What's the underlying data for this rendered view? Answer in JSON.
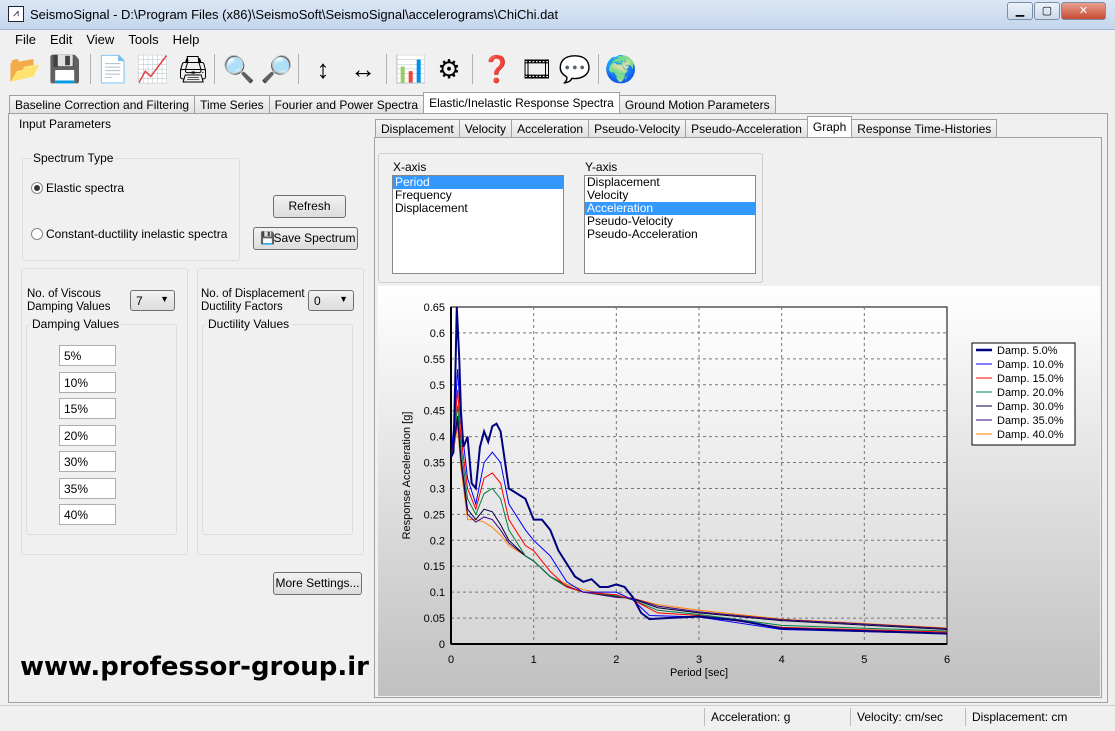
{
  "window": {
    "title": "SeismoSignal - D:\\Program Files (x86)\\SeismoSoft\\SeismoSignal\\accelerograms\\ChiChi.dat",
    "minimize": "▁",
    "maximize": "▢",
    "close": "✕"
  },
  "menu": [
    "File",
    "Edit",
    "View",
    "Tools",
    "Help"
  ],
  "toolbar": [
    {
      "icon": "open-folder-icon",
      "g": "📂"
    },
    {
      "icon": "save-icon",
      "g": "💾"
    },
    {
      "icon": "document-icon",
      "g": "📄"
    },
    {
      "icon": "signal-document-icon",
      "g": "📈"
    },
    {
      "icon": "print-icon",
      "g": "🖨"
    },
    {
      "icon": "zoom-in-icon",
      "g": "🔍"
    },
    {
      "icon": "zoom-out-icon",
      "g": "🔎"
    },
    {
      "icon": "vertical-arrows-icon",
      "g": "↕"
    },
    {
      "icon": "horizontal-arrows-icon",
      "g": "↔"
    },
    {
      "icon": "chart-icon",
      "g": "📊"
    },
    {
      "icon": "gear-icon",
      "g": "⚙"
    },
    {
      "icon": "help-icon",
      "g": "❓"
    },
    {
      "icon": "film-reel-icon",
      "g": "🎞"
    },
    {
      "icon": "chat-icon",
      "g": "💬"
    },
    {
      "icon": "globe-icon",
      "g": "🌍"
    }
  ],
  "main_tabs": [
    "Baseline Correction and Filtering",
    "Time Series",
    "Fourier and Power Spectra",
    "Elastic/Inelastic Response Spectra",
    "Ground Motion Parameters"
  ],
  "active_main_tab": 3,
  "input": {
    "title": "Input Parameters",
    "spectrum_type": "Spectrum Type",
    "elastic": "Elastic spectra",
    "inelastic": "Constant-ductility inelastic spectra",
    "refresh": "Refresh",
    "save_spectrum": "Save Spectrum",
    "viscous_label1": "No. of Viscous",
    "viscous_label2": "Damping Values",
    "viscous_count": "7",
    "damping_values_title": "Damping Values",
    "damping_values": [
      "5%",
      "10%",
      "15%",
      "20%",
      "30%",
      "35%",
      "40%"
    ],
    "ductility_label1": "No. of Displacement",
    "ductility_label2": "Ductility Factors",
    "ductility_count": "0",
    "ductility_values_title": "Ductility Values",
    "more_settings": "More Settings...",
    "watermark": "www.professor-group.ir"
  },
  "sub_tabs": [
    "Displacement",
    "Velocity",
    "Acceleration",
    "Pseudo-Velocity",
    "Pseudo-Acceleration",
    "Graph",
    "Response Time-Histories"
  ],
  "active_sub_tab": 5,
  "axes_select": {
    "x_label": "X-axis",
    "x_options": [
      "Period",
      "Frequency",
      "Displacement"
    ],
    "x_selected": 0,
    "y_label": "Y-axis",
    "y_options": [
      "Displacement",
      "Velocity",
      "Acceleration",
      "Pseudo-Velocity",
      "Pseudo-Acceleration"
    ],
    "y_selected": 2
  },
  "chart_data": {
    "type": "line",
    "xlabel": "Period [sec]",
    "ylabel": "Response Acceleration [g]",
    "xlim": [
      0,
      6
    ],
    "ylim": [
      0,
      0.65
    ],
    "xticks": [
      0,
      1,
      2,
      3,
      4,
      5,
      6
    ],
    "yticks": [
      0,
      0.05,
      0.1,
      0.15,
      0.2,
      0.25,
      0.3,
      0.35,
      0.4,
      0.45,
      0.5,
      0.55,
      0.6,
      0.65
    ],
    "grid": true,
    "legend": "right",
    "series": [
      {
        "name": "Damp. 5.0%",
        "color": "#000080",
        "x": [
          0,
          0.03,
          0.05,
          0.07,
          0.1,
          0.12,
          0.15,
          0.2,
          0.25,
          0.3,
          0.35,
          0.4,
          0.45,
          0.5,
          0.55,
          0.6,
          0.7,
          0.8,
          0.9,
          1.0,
          1.1,
          1.2,
          1.3,
          1.4,
          1.5,
          1.6,
          1.7,
          1.8,
          1.9,
          2.0,
          2.1,
          2.2,
          2.3,
          2.4,
          2.6,
          3.0,
          3.5,
          4,
          5,
          6
        ],
        "y": [
          0.36,
          0.37,
          0.5,
          0.65,
          0.55,
          0.45,
          0.38,
          0.4,
          0.31,
          0.3,
          0.38,
          0.41,
          0.39,
          0.42,
          0.425,
          0.41,
          0.3,
          0.29,
          0.28,
          0.24,
          0.24,
          0.22,
          0.18,
          0.155,
          0.13,
          0.12,
          0.125,
          0.11,
          0.11,
          0.115,
          0.11,
          0.09,
          0.06,
          0.048,
          0.05,
          0.053,
          0.045,
          0.03,
          0.025,
          0.02
        ]
      },
      {
        "name": "Damp. 10.0%",
        "color": "#0000ff",
        "x": [
          0,
          0.05,
          0.08,
          0.12,
          0.2,
          0.3,
          0.4,
          0.5,
          0.6,
          0.7,
          0.9,
          1.0,
          1.2,
          1.4,
          1.6,
          2.0,
          2.2,
          2.4,
          3,
          4,
          6
        ],
        "y": [
          0.36,
          0.45,
          0.53,
          0.43,
          0.32,
          0.27,
          0.35,
          0.37,
          0.35,
          0.27,
          0.22,
          0.2,
          0.17,
          0.12,
          0.1,
          0.1,
          0.085,
          0.055,
          0.052,
          0.028,
          0.02
        ]
      },
      {
        "name": "Damp. 15.0%",
        "color": "#ff0000",
        "x": [
          0,
          0.05,
          0.08,
          0.12,
          0.2,
          0.3,
          0.4,
          0.5,
          0.6,
          0.7,
          0.9,
          1.0,
          1.2,
          1.4,
          1.6,
          2.0,
          2.2,
          2.5,
          3,
          4,
          6
        ],
        "y": [
          0.36,
          0.43,
          0.49,
          0.4,
          0.3,
          0.26,
          0.32,
          0.33,
          0.31,
          0.24,
          0.19,
          0.18,
          0.14,
          0.11,
          0.1,
          0.095,
          0.085,
          0.06,
          0.055,
          0.032,
          0.023
        ]
      },
      {
        "name": "Damp. 20.0%",
        "color": "#008040",
        "x": [
          0,
          0.05,
          0.08,
          0.12,
          0.2,
          0.3,
          0.4,
          0.5,
          0.6,
          0.7,
          0.9,
          1.0,
          1.2,
          1.4,
          1.6,
          2.0,
          2.2,
          2.5,
          3,
          4,
          6
        ],
        "y": [
          0.36,
          0.42,
          0.46,
          0.38,
          0.28,
          0.25,
          0.29,
          0.3,
          0.28,
          0.22,
          0.17,
          0.16,
          0.13,
          0.11,
          0.1,
          0.093,
          0.085,
          0.065,
          0.057,
          0.036,
          0.025
        ]
      },
      {
        "name": "Damp. 30.0%",
        "color": "#000040",
        "x": [
          0,
          0.05,
          0.08,
          0.12,
          0.2,
          0.3,
          0.4,
          0.5,
          0.6,
          0.7,
          0.9,
          1.0,
          1.2,
          1.4,
          1.6,
          2.0,
          2.2,
          2.5,
          3,
          4,
          6
        ],
        "y": [
          0.36,
          0.41,
          0.44,
          0.36,
          0.26,
          0.24,
          0.26,
          0.255,
          0.23,
          0.2,
          0.17,
          0.16,
          0.13,
          0.11,
          0.1,
          0.092,
          0.087,
          0.07,
          0.06,
          0.045,
          0.028
        ]
      },
      {
        "name": "Damp. 35.0%",
        "color": "#400080",
        "x": [
          0,
          0.05,
          0.08,
          0.12,
          0.2,
          0.3,
          0.4,
          0.5,
          0.6,
          0.7,
          0.9,
          1.0,
          1.2,
          1.4,
          1.6,
          2.0,
          2.2,
          2.5,
          3,
          4,
          6
        ],
        "y": [
          0.36,
          0.4,
          0.43,
          0.35,
          0.25,
          0.235,
          0.245,
          0.24,
          0.22,
          0.195,
          0.17,
          0.16,
          0.13,
          0.112,
          0.1,
          0.09,
          0.088,
          0.073,
          0.062,
          0.047,
          0.03
        ]
      },
      {
        "name": "Damp. 40.0%",
        "color": "#ff8000",
        "x": [
          0,
          0.05,
          0.08,
          0.12,
          0.2,
          0.3,
          0.4,
          0.5,
          0.6,
          0.7,
          0.9,
          1.0,
          1.2,
          1.4,
          1.6,
          2.0,
          2.2,
          2.5,
          3,
          4,
          6
        ],
        "y": [
          0.36,
          0.39,
          0.42,
          0.34,
          0.24,
          0.24,
          0.235,
          0.225,
          0.21,
          0.19,
          0.17,
          0.16,
          0.13,
          0.115,
          0.105,
          0.092,
          0.088,
          0.076,
          0.065,
          0.048,
          0.031
        ]
      }
    ]
  },
  "status": {
    "acceleration": "Acceleration: g",
    "velocity": "Velocity: cm/sec",
    "displacement": "Displacement: cm"
  }
}
